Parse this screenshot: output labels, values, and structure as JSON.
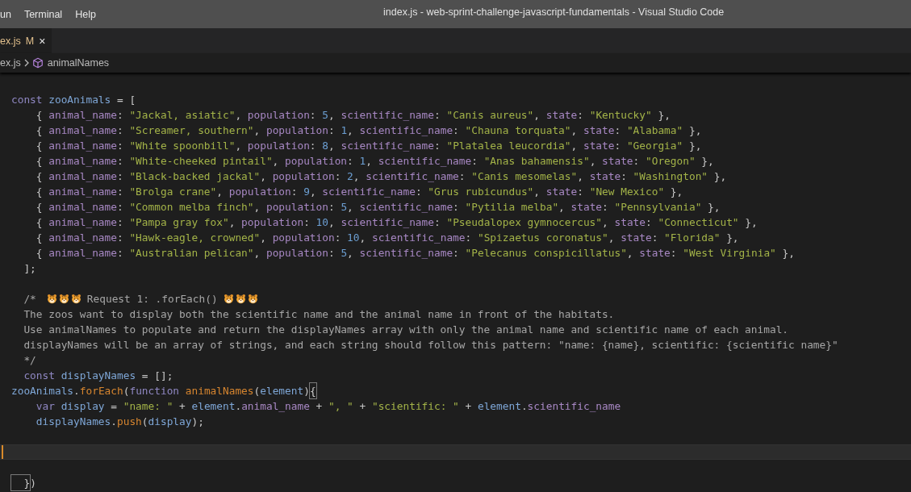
{
  "menu_bar": {
    "items": [
      "un",
      "Terminal",
      "Help"
    ]
  },
  "window": {
    "title": "index.js - web-sprint-challenge-javascript-fundamentals - Visual Studio Code"
  },
  "tabs": [
    {
      "label": "ex.js",
      "badge": "M",
      "close": "×",
      "selected": true
    }
  ],
  "breadcrumb": {
    "file": "ex.js",
    "symbol": "animalNames"
  },
  "editor": {
    "lines": [
      {
        "current": false,
        "tokens": [
          {
            "kind": "keyword",
            "text": "const"
          },
          {
            "kind": "variable",
            "text": " zooAnimals"
          },
          {
            "kind": "punct",
            "text": " = ["
          }
        ]
      },
      {
        "current": false,
        "tokens": [
          {
            "kind": "punct",
            "text": "    { "
          },
          {
            "kind": "property",
            "text": "animal_name"
          },
          {
            "kind": "punct",
            "text": ": "
          },
          {
            "kind": "string",
            "text": "\"Jackal, asiatic\""
          },
          {
            "kind": "punct",
            "text": ", "
          },
          {
            "kind": "property",
            "text": "population"
          },
          {
            "kind": "punct",
            "text": ": "
          },
          {
            "kind": "number",
            "text": "5"
          },
          {
            "kind": "punct",
            "text": ", "
          },
          {
            "kind": "property",
            "text": "scientific_name"
          },
          {
            "kind": "punct",
            "text": ": "
          },
          {
            "kind": "string",
            "text": "\"Canis aureus\""
          },
          {
            "kind": "punct",
            "text": ", "
          },
          {
            "kind": "property",
            "text": "state"
          },
          {
            "kind": "punct",
            "text": ": "
          },
          {
            "kind": "string",
            "text": "\"Kentucky\""
          },
          {
            "kind": "punct",
            "text": " },"
          }
        ]
      },
      {
        "current": false,
        "tokens": [
          {
            "kind": "punct",
            "text": "    { "
          },
          {
            "kind": "property",
            "text": "animal_name"
          },
          {
            "kind": "punct",
            "text": ": "
          },
          {
            "kind": "string",
            "text": "\"Screamer, southern\""
          },
          {
            "kind": "punct",
            "text": ", "
          },
          {
            "kind": "property",
            "text": "population"
          },
          {
            "kind": "punct",
            "text": ": "
          },
          {
            "kind": "number",
            "text": "1"
          },
          {
            "kind": "punct",
            "text": ", "
          },
          {
            "kind": "property",
            "text": "scientific_name"
          },
          {
            "kind": "punct",
            "text": ": "
          },
          {
            "kind": "string",
            "text": "\"Chauna torquata\""
          },
          {
            "kind": "punct",
            "text": ", "
          },
          {
            "kind": "property",
            "text": "state"
          },
          {
            "kind": "punct",
            "text": ": "
          },
          {
            "kind": "string",
            "text": "\"Alabama\""
          },
          {
            "kind": "punct",
            "text": " },"
          }
        ]
      },
      {
        "current": false,
        "tokens": [
          {
            "kind": "punct",
            "text": "    { "
          },
          {
            "kind": "property",
            "text": "animal_name"
          },
          {
            "kind": "punct",
            "text": ": "
          },
          {
            "kind": "string",
            "text": "\"White spoonbill\""
          },
          {
            "kind": "punct",
            "text": ", "
          },
          {
            "kind": "property",
            "text": "population"
          },
          {
            "kind": "punct",
            "text": ": "
          },
          {
            "kind": "number",
            "text": "8"
          },
          {
            "kind": "punct",
            "text": ", "
          },
          {
            "kind": "property",
            "text": "scientific_name"
          },
          {
            "kind": "punct",
            "text": ": "
          },
          {
            "kind": "string",
            "text": "\"Platalea leucordia\""
          },
          {
            "kind": "punct",
            "text": ", "
          },
          {
            "kind": "property",
            "text": "state"
          },
          {
            "kind": "punct",
            "text": ": "
          },
          {
            "kind": "string",
            "text": "\"Georgia\""
          },
          {
            "kind": "punct",
            "text": " },"
          }
        ]
      },
      {
        "current": false,
        "tokens": [
          {
            "kind": "punct",
            "text": "    { "
          },
          {
            "kind": "property",
            "text": "animal_name"
          },
          {
            "kind": "punct",
            "text": ": "
          },
          {
            "kind": "string",
            "text": "\"White-cheeked pintail\""
          },
          {
            "kind": "punct",
            "text": ", "
          },
          {
            "kind": "property",
            "text": "population"
          },
          {
            "kind": "punct",
            "text": ": "
          },
          {
            "kind": "number",
            "text": "1"
          },
          {
            "kind": "punct",
            "text": ", "
          },
          {
            "kind": "property",
            "text": "scientific_name"
          },
          {
            "kind": "punct",
            "text": ": "
          },
          {
            "kind": "string",
            "text": "\"Anas bahamensis\""
          },
          {
            "kind": "punct",
            "text": ", "
          },
          {
            "kind": "property",
            "text": "state"
          },
          {
            "kind": "punct",
            "text": ": "
          },
          {
            "kind": "string",
            "text": "\"Oregon\""
          },
          {
            "kind": "punct",
            "text": " },"
          }
        ]
      },
      {
        "current": false,
        "tokens": [
          {
            "kind": "punct",
            "text": "    { "
          },
          {
            "kind": "property",
            "text": "animal_name"
          },
          {
            "kind": "punct",
            "text": ": "
          },
          {
            "kind": "string",
            "text": "\"Black-backed jackal\""
          },
          {
            "kind": "punct",
            "text": ", "
          },
          {
            "kind": "property",
            "text": "population"
          },
          {
            "kind": "punct",
            "text": ": "
          },
          {
            "kind": "number",
            "text": "2"
          },
          {
            "kind": "punct",
            "text": ", "
          },
          {
            "kind": "property",
            "text": "scientific_name"
          },
          {
            "kind": "punct",
            "text": ": "
          },
          {
            "kind": "string",
            "text": "\"Canis mesomelas\""
          },
          {
            "kind": "punct",
            "text": ", "
          },
          {
            "kind": "property",
            "text": "state"
          },
          {
            "kind": "punct",
            "text": ": "
          },
          {
            "kind": "string",
            "text": "\"Washington\""
          },
          {
            "kind": "punct",
            "text": " },"
          }
        ]
      },
      {
        "current": false,
        "tokens": [
          {
            "kind": "punct",
            "text": "    { "
          },
          {
            "kind": "property",
            "text": "animal_name"
          },
          {
            "kind": "punct",
            "text": ": "
          },
          {
            "kind": "string",
            "text": "\"Brolga crane\""
          },
          {
            "kind": "punct",
            "text": ", "
          },
          {
            "kind": "property",
            "text": "population"
          },
          {
            "kind": "punct",
            "text": ": "
          },
          {
            "kind": "number",
            "text": "9"
          },
          {
            "kind": "punct",
            "text": ", "
          },
          {
            "kind": "property",
            "text": "scientific_name"
          },
          {
            "kind": "punct",
            "text": ": "
          },
          {
            "kind": "string",
            "text": "\"Grus rubicundus\""
          },
          {
            "kind": "punct",
            "text": ", "
          },
          {
            "kind": "property",
            "text": "state"
          },
          {
            "kind": "punct",
            "text": ": "
          },
          {
            "kind": "string",
            "text": "\"New Mexico\""
          },
          {
            "kind": "punct",
            "text": " },"
          }
        ]
      },
      {
        "current": false,
        "tokens": [
          {
            "kind": "punct",
            "text": "    { "
          },
          {
            "kind": "property",
            "text": "animal_name"
          },
          {
            "kind": "punct",
            "text": ": "
          },
          {
            "kind": "string",
            "text": "\"Common melba finch\""
          },
          {
            "kind": "punct",
            "text": ", "
          },
          {
            "kind": "property",
            "text": "population"
          },
          {
            "kind": "punct",
            "text": ": "
          },
          {
            "kind": "number",
            "text": "5"
          },
          {
            "kind": "punct",
            "text": ", "
          },
          {
            "kind": "property",
            "text": "scientific_name"
          },
          {
            "kind": "punct",
            "text": ": "
          },
          {
            "kind": "string",
            "text": "\"Pytilia melba\""
          },
          {
            "kind": "punct",
            "text": ", "
          },
          {
            "kind": "property",
            "text": "state"
          },
          {
            "kind": "punct",
            "text": ": "
          },
          {
            "kind": "string",
            "text": "\"Pennsylvania\""
          },
          {
            "kind": "punct",
            "text": " },"
          }
        ]
      },
      {
        "current": false,
        "tokens": [
          {
            "kind": "punct",
            "text": "    { "
          },
          {
            "kind": "property",
            "text": "animal_name"
          },
          {
            "kind": "punct",
            "text": ": "
          },
          {
            "kind": "string",
            "text": "\"Pampa gray fox\""
          },
          {
            "kind": "punct",
            "text": ", "
          },
          {
            "kind": "property",
            "text": "population"
          },
          {
            "kind": "punct",
            "text": ": "
          },
          {
            "kind": "number",
            "text": "10"
          },
          {
            "kind": "punct",
            "text": ", "
          },
          {
            "kind": "property",
            "text": "scientific_name"
          },
          {
            "kind": "punct",
            "text": ": "
          },
          {
            "kind": "string",
            "text": "\"Pseudalopex gymnocercus\""
          },
          {
            "kind": "punct",
            "text": ", "
          },
          {
            "kind": "property",
            "text": "state"
          },
          {
            "kind": "punct",
            "text": ": "
          },
          {
            "kind": "string",
            "text": "\"Connecticut\""
          },
          {
            "kind": "punct",
            "text": " },"
          }
        ]
      },
      {
        "current": false,
        "tokens": [
          {
            "kind": "punct",
            "text": "    { "
          },
          {
            "kind": "property",
            "text": "animal_name"
          },
          {
            "kind": "punct",
            "text": ": "
          },
          {
            "kind": "string",
            "text": "\"Hawk-eagle, crowned\""
          },
          {
            "kind": "punct",
            "text": ", "
          },
          {
            "kind": "property",
            "text": "population"
          },
          {
            "kind": "punct",
            "text": ": "
          },
          {
            "kind": "number",
            "text": "10"
          },
          {
            "kind": "punct",
            "text": ", "
          },
          {
            "kind": "property",
            "text": "scientific_name"
          },
          {
            "kind": "punct",
            "text": ": "
          },
          {
            "kind": "string",
            "text": "\"Spizaetus coronatus\""
          },
          {
            "kind": "punct",
            "text": ", "
          },
          {
            "kind": "property",
            "text": "state"
          },
          {
            "kind": "punct",
            "text": ": "
          },
          {
            "kind": "string",
            "text": "\"Florida\""
          },
          {
            "kind": "punct",
            "text": " },"
          }
        ]
      },
      {
        "current": false,
        "tokens": [
          {
            "kind": "punct",
            "text": "    { "
          },
          {
            "kind": "property",
            "text": "animal_name"
          },
          {
            "kind": "punct",
            "text": ": "
          },
          {
            "kind": "string",
            "text": "\"Australian pelican\""
          },
          {
            "kind": "punct",
            "text": ", "
          },
          {
            "kind": "property",
            "text": "population"
          },
          {
            "kind": "punct",
            "text": ": "
          },
          {
            "kind": "number",
            "text": "5"
          },
          {
            "kind": "punct",
            "text": ", "
          },
          {
            "kind": "property",
            "text": "scientific_name"
          },
          {
            "kind": "punct",
            "text": ": "
          },
          {
            "kind": "string",
            "text": "\"Pelecanus conspicillatus\""
          },
          {
            "kind": "punct",
            "text": ", "
          },
          {
            "kind": "property",
            "text": "state"
          },
          {
            "kind": "punct",
            "text": ": "
          },
          {
            "kind": "string",
            "text": "\"West Virginia\""
          },
          {
            "kind": "punct",
            "text": " },"
          }
        ]
      },
      {
        "current": false,
        "tokens": [
          {
            "kind": "punct",
            "text": "  ];"
          }
        ]
      },
      {
        "current": false
      },
      {
        "current": false,
        "tokens": [
          {
            "kind": "comment",
            "text": "  /*"
          },
          {
            "kind": "icon"
          },
          {
            "kind": "icon"
          },
          {
            "kind": "icon"
          },
          {
            "kind": "comment",
            "text": "Request 1: .forEach()"
          },
          {
            "kind": "icon"
          },
          {
            "kind": "icon"
          },
          {
            "kind": "icon"
          }
        ]
      },
      {
        "current": false,
        "tokens": [
          {
            "kind": "comment",
            "text": "  The zoos want to display both the scientific name and the animal name in front of the habitats."
          }
        ]
      },
      {
        "current": false,
        "tokens": [
          {
            "kind": "comment",
            "text": "  Use animalNames to populate and return the displayNames array with only the animal name and scientific name of each animal."
          }
        ]
      },
      {
        "current": false,
        "tokens": [
          {
            "kind": "comment",
            "text": "  displayNames will be an array of strings, and each string should follow this pattern: \"name: {name}, scientific: {scientific name}\""
          }
        ]
      },
      {
        "current": false,
        "tokens": [
          {
            "kind": "comment",
            "text": "  */"
          }
        ]
      },
      {
        "current": false,
        "tokens": [
          {
            "kind": "keyword",
            "text": "  const"
          },
          {
            "kind": "variable",
            "text": " displayNames"
          },
          {
            "kind": "punct",
            "text": " = [];"
          }
        ]
      },
      {
        "current": false,
        "tokens": [
          {
            "kind": "variable",
            "text": "zooAnimals"
          },
          {
            "kind": "punct",
            "text": "."
          },
          {
            "kind": "function",
            "text": "forEach"
          },
          {
            "kind": "punct",
            "text": "("
          },
          {
            "kind": "keyword",
            "text": "function"
          },
          {
            "kind": "function",
            "text": " animalNames"
          },
          {
            "kind": "punct",
            "text": "("
          },
          {
            "kind": "variable",
            "text": "element"
          },
          {
            "kind": "punct",
            "text": ")"
          },
          {
            "kind": "bracket",
            "text": "{"
          }
        ]
      },
      {
        "current": false,
        "tokens": [
          {
            "kind": "keyword",
            "text": "    var"
          },
          {
            "kind": "variable",
            "text": " display"
          },
          {
            "kind": "punct",
            "text": " = "
          },
          {
            "kind": "string",
            "text": "\"name: \""
          },
          {
            "kind": "punct",
            "text": " + "
          },
          {
            "kind": "variable",
            "text": "element"
          },
          {
            "kind": "punct",
            "text": "."
          },
          {
            "kind": "property",
            "text": "animal_name"
          },
          {
            "kind": "punct",
            "text": " + "
          },
          {
            "kind": "string",
            "text": "\", \""
          },
          {
            "kind": "punct",
            "text": " + "
          },
          {
            "kind": "string",
            "text": "\"scientific: \""
          },
          {
            "kind": "punct",
            "text": " + "
          },
          {
            "kind": "variable",
            "text": "element"
          },
          {
            "kind": "punct",
            "text": "."
          },
          {
            "kind": "property",
            "text": "scientific_name"
          }
        ]
      },
      {
        "current": false,
        "tokens": [
          {
            "kind": "variable",
            "text": "    displayNames"
          },
          {
            "kind": "punct",
            "text": "."
          },
          {
            "kind": "function",
            "text": "push"
          },
          {
            "kind": "punct",
            "text": "("
          },
          {
            "kind": "variable",
            "text": "display"
          },
          {
            "kind": "punct",
            "text": ");"
          }
        ]
      },
      {
        "current": false
      },
      {
        "current": true
      },
      {
        "current": false
      },
      {
        "current": false,
        "tokens": [
          {
            "kind": "bracket",
            "text": "  }"
          },
          {
            "kind": "punct",
            "text": ")"
          }
        ]
      }
    ]
  }
}
